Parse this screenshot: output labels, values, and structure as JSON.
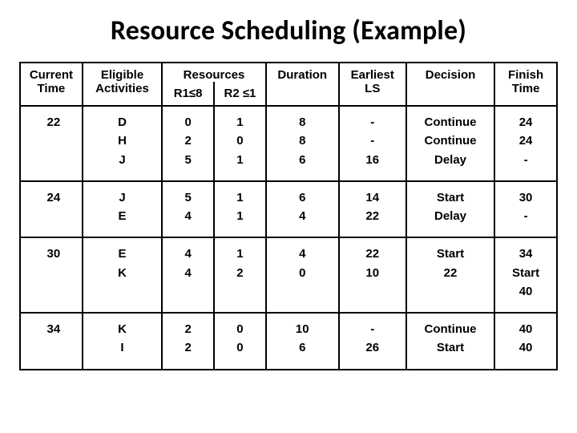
{
  "title": "Resource Scheduling (Example)",
  "headers": {
    "current_time": "Current Time",
    "eligible": "Eligible Activities",
    "resources": "Resources",
    "r1": "R1≤8",
    "r2": "R2 ≤1",
    "duration": "Duration",
    "ls": "Earliest LS",
    "decision": "Decision",
    "finish": "Finish Time"
  },
  "rows": [
    {
      "time": "22",
      "activities": [
        "D",
        "H",
        "J"
      ],
      "r1": [
        "0",
        "2",
        "5"
      ],
      "r2": [
        "1",
        "0",
        "1"
      ],
      "duration": [
        "8",
        "8",
        "6"
      ],
      "ls": [
        "-",
        "-",
        "16"
      ],
      "decision": [
        "Continue",
        "Continue",
        "Delay"
      ],
      "finish": [
        "24",
        "24",
        "-"
      ]
    },
    {
      "time": "24",
      "activities": [
        "J",
        "E"
      ],
      "r1": [
        "5",
        "4"
      ],
      "r2": [
        "1",
        "1"
      ],
      "duration": [
        "6",
        "4"
      ],
      "ls": [
        "14",
        "22"
      ],
      "decision": [
        "Start",
        "Delay"
      ],
      "finish": [
        "30",
        "-"
      ]
    },
    {
      "time": "30",
      "activities": [
        "E",
        "K"
      ],
      "r1": [
        "4",
        "4"
      ],
      "r2": [
        "1",
        "2"
      ],
      "duration": [
        "4",
        "0"
      ],
      "ls": [
        "22",
        "10"
      ],
      "decision": [
        "Start",
        "22"
      ],
      "finish": [
        "34",
        "Start",
        "40"
      ]
    },
    {
      "time": "34",
      "activities": [
        "K",
        "I"
      ],
      "r1": [
        "2",
        "2"
      ],
      "r2": [
        "0",
        "0"
      ],
      "duration": [
        "10",
        "6"
      ],
      "ls": [
        "-",
        "26"
      ],
      "decision": [
        "Continue",
        "Start"
      ],
      "finish": [
        "40",
        "40"
      ]
    }
  ],
  "chart_data": {
    "type": "table",
    "title": "Resource Scheduling (Example)",
    "columns": [
      "Current Time",
      "Eligible Activities",
      "R1≤8",
      "R2 ≤1",
      "Duration",
      "Earliest LS",
      "Decision",
      "Finish Time"
    ],
    "rows": [
      [
        "22",
        "D",
        "0",
        "1",
        "8",
        "-",
        "Continue",
        "24"
      ],
      [
        "22",
        "H",
        "2",
        "0",
        "8",
        "-",
        "Continue",
        "24"
      ],
      [
        "22",
        "J",
        "5",
        "1",
        "6",
        "16",
        "Delay",
        "-"
      ],
      [
        "24",
        "J",
        "5",
        "1",
        "6",
        "14",
        "Start",
        "30"
      ],
      [
        "24",
        "E",
        "4",
        "1",
        "4",
        "22",
        "Delay",
        "-"
      ],
      [
        "30",
        "E",
        "4",
        "1",
        "4",
        "22",
        "Start",
        "34"
      ],
      [
        "30",
        "K",
        "4",
        "2",
        "0",
        "10",
        "22",
        "Start 40"
      ],
      [
        "34",
        "K",
        "2",
        "0",
        "10",
        "-",
        "Continue",
        "40"
      ],
      [
        "34",
        "I",
        "2",
        "0",
        "6",
        "26",
        "Start",
        "40"
      ]
    ]
  }
}
